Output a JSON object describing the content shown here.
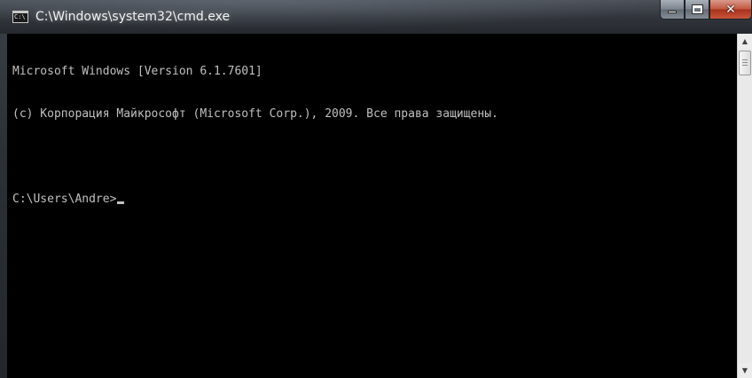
{
  "window": {
    "title": "C:\\Windows\\system32\\cmd.exe",
    "icon_text": "C:\\",
    "buttons": {
      "minimize": "minimize",
      "maximize": "maximize",
      "close": "✕"
    }
  },
  "console": {
    "lines": [
      "Microsoft Windows [Version 6.1.7601]",
      "(c) Корпорация Майкрософт (Microsoft Corp.), 2009. Все права защищены.",
      "",
      "C:\\Users\\Andre>"
    ],
    "text_color": "#c0c0c0",
    "background_color": "#000000"
  },
  "scrollbar": {
    "up_arrow": "▲",
    "down_arrow": "▼"
  }
}
